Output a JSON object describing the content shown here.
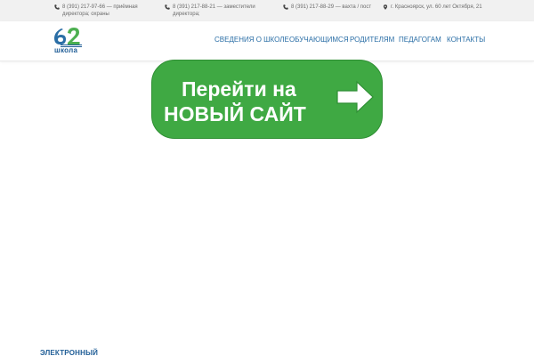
{
  "topbar": {
    "contact1": "8 (391) 217-97-66 — приёмная директора; охраны",
    "contact2": "8 (391) 217-88-21 — заместители директора;",
    "contact3": "8 (391) 217-88-29 — вахта / пост",
    "address": "г. Красноярск, ул. 60 лет Октября, 21"
  },
  "logo": {
    "number": "62",
    "word": "школа",
    "colors": {
      "six": "#2a6ea6",
      "two": "#4caf50",
      "stripe": "#1f5d96"
    }
  },
  "nav": [
    "СВЕДЕНИЯ О ШКОЛЕ",
    "ОБУЧАЮЩИМСЯ",
    "РОДИТЕЛЯМ",
    "ПЕДАГОГАМ",
    "КОНТАКТЫ"
  ],
  "banner": {
    "line1": "Перейти на",
    "line2": "НОВЫЙ САЙТ",
    "color": "#3fa943"
  },
  "bottom": {
    "label": "ЭЛЕКТРОННЫЙ"
  }
}
